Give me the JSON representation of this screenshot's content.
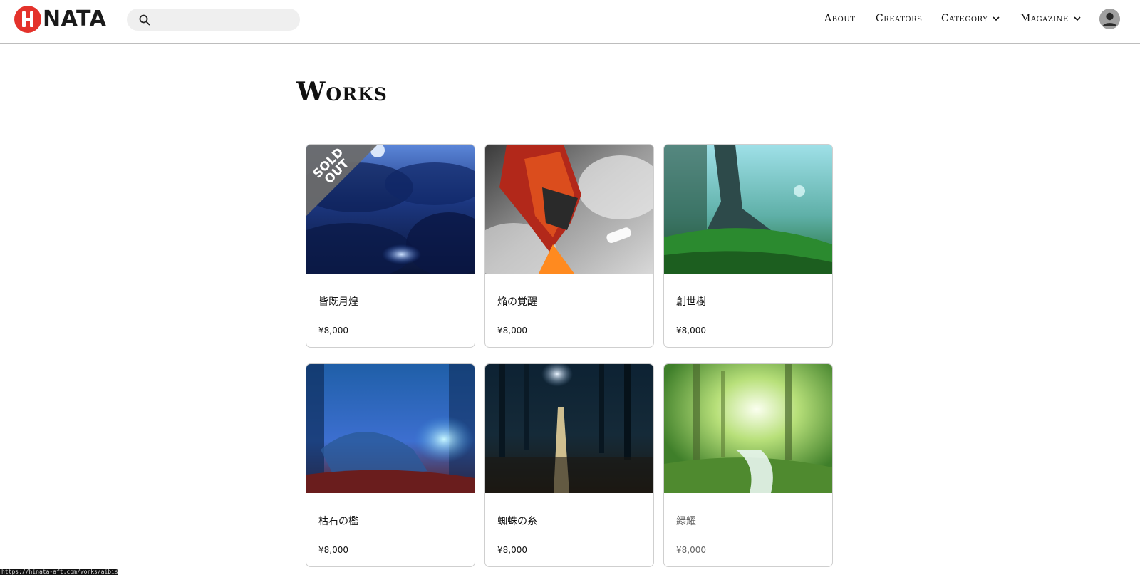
{
  "header": {
    "logo_text": "NATA",
    "search_placeholder": "",
    "nav": {
      "about": "About",
      "creators": "Creators",
      "category": "Category",
      "magazine": "Magazine"
    }
  },
  "page": {
    "title": "Works"
  },
  "works": [
    {
      "title": "皆既月煌",
      "price": "¥8,000",
      "badge": "SOLD OUT",
      "sold_out": true
    },
    {
      "title": "焔の覚醒",
      "price": "¥8,000"
    },
    {
      "title": "創世樹",
      "price": "¥8,000"
    },
    {
      "title": "枯石の檻",
      "price": "¥8,000"
    },
    {
      "title": "蜘蛛の糸",
      "price": "¥8,000"
    },
    {
      "title": "緑耀",
      "price": "¥8,000"
    }
  ],
  "status_bar": {
    "url": "https://hinata-aft.com/works/aibis-03"
  },
  "colors": {
    "brand_red": "#e4322b",
    "sold_badge": "#6b6b6b",
    "border": "#cfcfcf"
  }
}
